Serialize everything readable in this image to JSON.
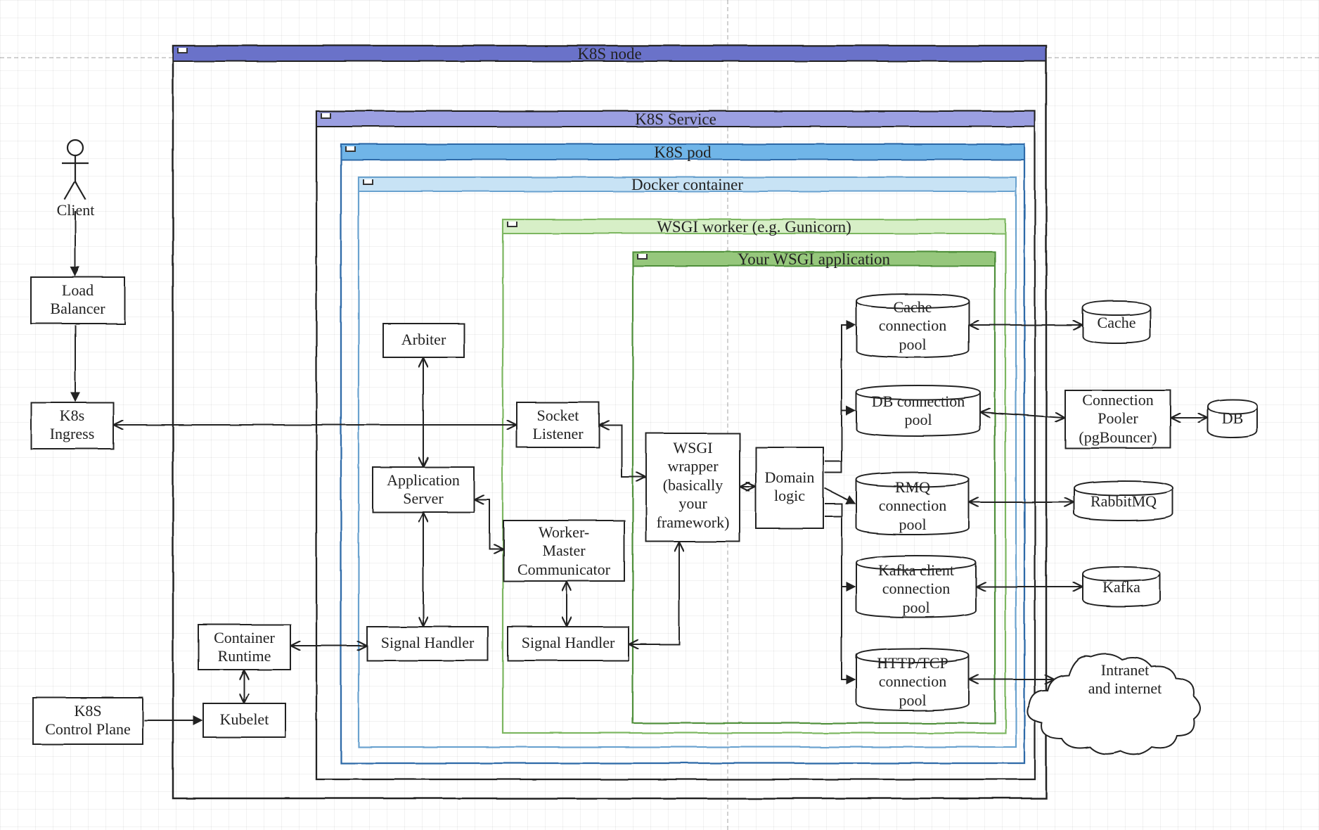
{
  "actors": {
    "client": "Client"
  },
  "externals": {
    "load_balancer": "Load\nBalancer",
    "k8s_ingress": "K8s\nIngress",
    "k8s_control_plane": "K8S\nControl Plane",
    "cache": "Cache",
    "connection_pooler": "Connection\nPooler\n(pgBouncer)",
    "db": "DB",
    "rabbitmq": "RabbitMQ",
    "kafka": "Kafka",
    "intranet_internet": "Intranet\nand internet"
  },
  "frames": {
    "k8s_node": "K8S node",
    "k8s_service": "K8S Service",
    "k8s_pod": "K8S pod",
    "docker_container": "Docker container",
    "wsgi_worker": "WSGI worker (e.g. Gunicorn)",
    "wsgi_app": "Your WSGI application"
  },
  "node_boxes": {
    "container_runtime": "Container\nRuntime",
    "kubelet": "Kubelet"
  },
  "docker_boxes": {
    "arbiter": "Arbiter",
    "application_server": "Application\nServer",
    "signal_handler_docker": "Signal Handler"
  },
  "worker_boxes": {
    "socket_listener": "Socket\nListener",
    "worker_master_communicator": "Worker-\nMaster\nCommunicator",
    "signal_handler_worker": "Signal Handler"
  },
  "app_boxes": {
    "wsgi_wrapper": "WSGI\nwrapper\n(basically\nyour\nframework)",
    "domain_logic": "Domain\nlogic",
    "cache_pool": "Cache\nconnection\npool",
    "db_pool": "DB connection\npool",
    "rmq_pool": "RMQ\nconnection\npool",
    "kafka_pool": "Kafka client\nconnection\npool",
    "http_pool": "HTTP/TCP\nconnection\npool"
  },
  "colors": {
    "k8s_node_header": "#6a72c9",
    "k8s_service_header": "#9b9fe1",
    "k8s_pod_header": "#6fb5e8",
    "docker_header": "#c8e3f5",
    "wsgi_worker_header": "#d7efc7",
    "wsgi_app_header": "#96c77b",
    "k8s_pod_border": "#2f6aa8",
    "docker_border": "#6aa2cf",
    "wsgi_worker_border": "#7bb661",
    "wsgi_app_border": "#4f8f3b"
  }
}
